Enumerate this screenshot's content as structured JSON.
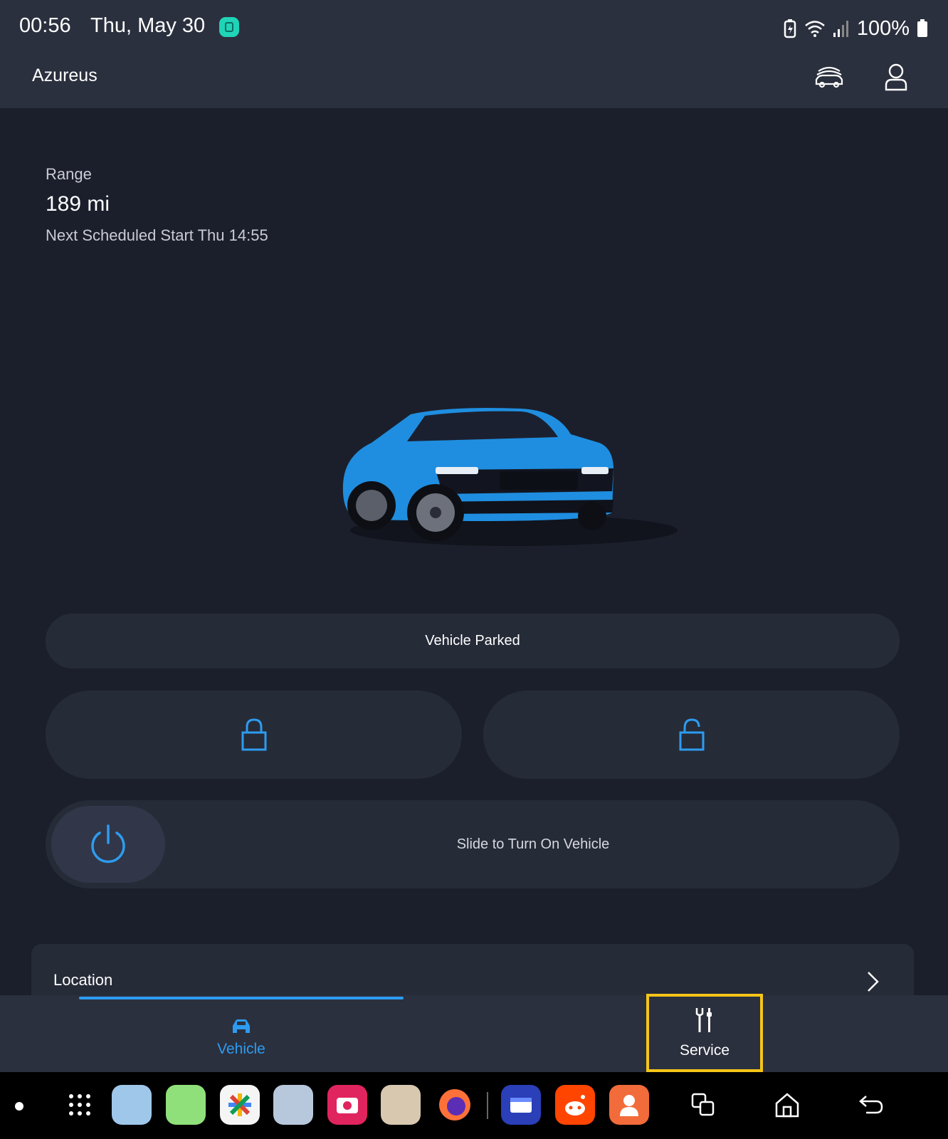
{
  "status_bar": {
    "time": "00:56",
    "date": "Thu, May 30",
    "battery": "100%",
    "icons": [
      "notes-app-icon",
      "battery-saver-icon",
      "wifi-icon",
      "signal-icon",
      "battery-icon"
    ]
  },
  "header": {
    "title": "Azureus",
    "icons": [
      "vehicles-icon",
      "account-icon"
    ]
  },
  "vehicle_info": {
    "range_label": "Range",
    "range_value": "189  mi",
    "next_schedule": "Next Scheduled Start Thu 14:55"
  },
  "status_pill": {
    "text": "Vehicle Parked"
  },
  "controls": {
    "lock_icon": "lock-icon",
    "unlock_icon": "unlock-icon",
    "slider_text": "Slide to Turn On Vehicle",
    "power_icon": "power-icon",
    "accent_color": "#2d9cf0"
  },
  "location": {
    "label": "Location"
  },
  "tabs": [
    {
      "label": "Vehicle",
      "icon": "car-icon",
      "active": true
    },
    {
      "label": "Service",
      "icon": "wrench-screwdriver-icon",
      "active": false
    }
  ],
  "highlight_color": "#f5c518",
  "navbar": {
    "apps": [
      "app-drawer",
      "folder-1",
      "folder-2",
      "photos",
      "folder-3",
      "screen-recorder",
      "folder-4",
      "firefox",
      "files",
      "reddit",
      "contacts"
    ],
    "buttons": [
      "recents-icon",
      "home-icon",
      "back-icon"
    ]
  }
}
